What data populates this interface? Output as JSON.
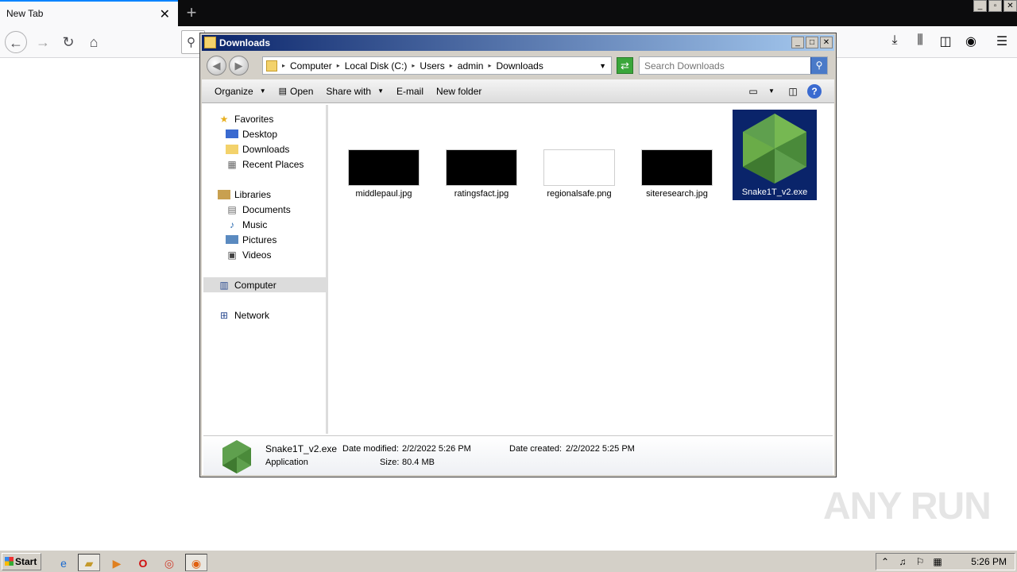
{
  "browser": {
    "tab_title": "New Tab",
    "tab_close": "✕",
    "new_tab": "+",
    "win_controls": [
      "_",
      "▫",
      "✕"
    ],
    "icons": {
      "back": "back-arrow-icon",
      "forward": "forward-arrow-icon",
      "reload": "reload-icon",
      "home": "home-icon",
      "search": "search-icon",
      "downloads": "download-icon",
      "library": "library-icon",
      "sidebar": "sidebar-icon",
      "account": "account-icon",
      "menu": "hamburger-menu-icon"
    }
  },
  "explorer": {
    "title": "Downloads",
    "win_controls": [
      "_",
      "□",
      "✕"
    ],
    "breadcrumb": [
      "Computer",
      "Local Disk (C:)",
      "Users",
      "admin",
      "Downloads"
    ],
    "search_placeholder": "Search Downloads",
    "toolbar": {
      "organize": "Organize",
      "open": "Open",
      "share_with": "Share with",
      "email": "E-mail",
      "new_folder": "New folder",
      "help": "?"
    },
    "nav": {
      "favorites": "Favorites",
      "desktop": "Desktop",
      "downloads": "Downloads",
      "recent_places": "Recent Places",
      "libraries": "Libraries",
      "documents": "Documents",
      "music": "Music",
      "pictures": "Pictures",
      "videos": "Videos",
      "computer": "Computer",
      "network": "Network"
    },
    "files": [
      {
        "name": "middlepaul.jpg",
        "thumb": "dark"
      },
      {
        "name": "ratingsfact.jpg",
        "thumb": "dark"
      },
      {
        "name": "regionalsafe.png",
        "thumb": "white"
      },
      {
        "name": "siteresearch.jpg",
        "thumb": "dark"
      },
      {
        "name": "Snake1T_v2.exe",
        "thumb": "nodejs-hex-icon",
        "selected": true
      }
    ],
    "details": {
      "filename": "Snake1T_v2.exe",
      "type": "Application",
      "date_modified_label": "Date modified:",
      "date_modified": "2/2/2022 5:26 PM",
      "size_label": "Size:",
      "size": "80.4 MB",
      "date_created_label": "Date created:",
      "date_created": "2/2/2022 5:25 PM"
    }
  },
  "watermark": "ANY RUN",
  "taskbar": {
    "start": "Start",
    "apps": [
      "ie-icon",
      "explorer-icon",
      "media-player-icon",
      "opera-icon",
      "chrome-icon",
      "firefox-icon"
    ],
    "tray_icons": [
      "up-arrow",
      "speaker-icon",
      "flag-icon",
      "network-icon"
    ],
    "time": "5:26 PM"
  },
  "colors": {
    "selection": "#0a246a",
    "title_gradient_start": "#0a246a",
    "title_gradient_end": "#a6caf0",
    "node_green": "#5fa04e"
  }
}
